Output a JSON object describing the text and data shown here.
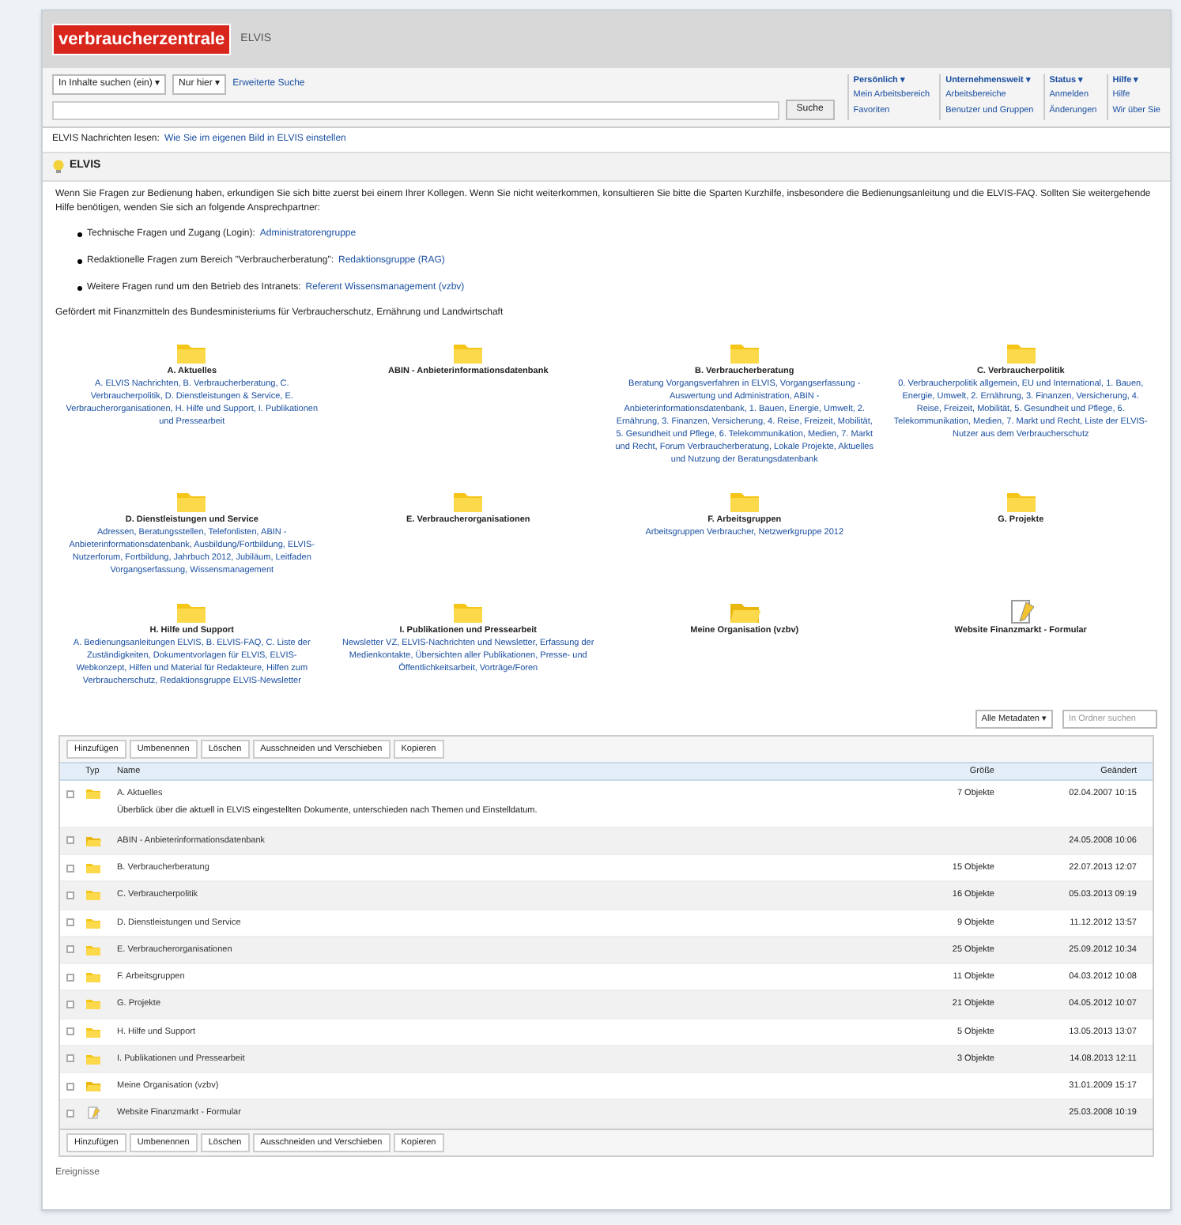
{
  "header": {
    "logo": "verbraucherzentrale",
    "subtitle": "ELVIS"
  },
  "search": {
    "scope": "In Inhalte suchen (ein) ▾",
    "filter": "Nur hier ▾",
    "advanced": "Erweiterte Suche",
    "button": "Suche"
  },
  "menus": [
    {
      "label": "Persönlich ▾",
      "items": [
        "Mein Arbeitsbereich",
        "Favoriten"
      ]
    },
    {
      "label": "Unternehmensweit ▾",
      "items": [
        "Arbeitsbereiche",
        "Benutzer und Gruppen"
      ]
    },
    {
      "label": "Status ▾",
      "items": [
        "Anmelden",
        "Änderungen"
      ]
    },
    {
      "label": "Hilfe ▾",
      "items": [
        "Hilfe",
        "Wir über Sie"
      ]
    }
  ],
  "breadcrumb": {
    "label": "ELVIS Nachrichten lesen:",
    "link": "Wie Sie im eigenen Bild in ELVIS einstellen"
  },
  "page_title": "ELVIS",
  "intro": "Wenn Sie Fragen zur Bedienung haben, erkundigen Sie sich bitte zuerst bei einem Ihrer Kollegen. Wenn Sie nicht weiterkommen, konsultieren Sie bitte die Sparten Kurzhilfe, insbesondere die Bedienungsanleitung und die ELVIS-FAQ. Sollten Sie weitergehende Hilfe benötigen, wenden Sie sich an folgende Ansprechpartner:",
  "contacts": [
    {
      "text": "Technische Fragen und Zugang (Login):",
      "link": "Administratorengruppe"
    },
    {
      "text": "Redaktionelle Fragen zum Bereich \"Verbraucherberatung\":",
      "link": "Redaktionsgruppe (RAG)"
    },
    {
      "text": "Weitere Fragen rund um den Betrieb des Intranets:",
      "link": "Referent Wissensmanagement (vzbv)"
    }
  ],
  "funding": "Gefördert mit Finanzmitteln des Bundesministeriums für Verbraucherschutz, Ernährung und Landwirtschaft",
  "folders": [
    {
      "kind": "folder",
      "title": "A. Aktuelles",
      "description": "A. ELVIS Nachrichten, B. Verbraucherberatung, C. Verbraucherpolitik, D. Dienstleistungen & Service, E. Verbraucherorganisationen, H. Hilfe und Support, I. Publikationen und Pressearbeit"
    },
    {
      "kind": "folder",
      "title": "ABIN - Anbieterinformationsdatenbank"
    },
    {
      "kind": "folder",
      "title": "B. Verbraucherberatung",
      "description": "Beratung Vorgangsverfahren in ELVIS, Vorgangserfassung - Auswertung und Administration, ABIN - Anbieterinformationsdatenbank, 1. Bauen, Energie, Umwelt, 2. Ernährung, 3. Finanzen, Versicherung, 4. Reise, Freizeit, Mobilität, 5. Gesundheit und Pflege, 6. Telekommunikation, Medien, 7. Markt und Recht, Forum Verbraucherberatung, Lokale Projekte, Aktuelles und Nutzung der Beratungsdatenbank"
    },
    {
      "kind": "folder",
      "title": "C. Verbraucherpolitik",
      "description": "0. Verbraucherpolitik allgemein, EU und International, 1. Bauen, Energie, Umwelt, 2. Ernährung, 3. Finanzen, Versicherung, 4. Reise, Freizeit, Mobilität, 5. Gesundheit und Pflege, 6. Telekommunikation, Medien, 7. Markt und Recht, Liste der ELVIS-Nutzer aus dem Verbraucherschutz"
    },
    {
      "kind": "folder",
      "title": "D. Dienstleistungen und Service",
      "description": "Adressen, Beratungsstellen, Telefonlisten, ABIN - Anbieterinformationsdatenbank, Ausbildung/Fortbildung, ELVIS-Nutzerforum, Fortbildung, Jahrbuch 2012, Jubiläum, Leitfaden Vorgangserfassung, Wissensmanagement"
    },
    {
      "kind": "folder",
      "title": "E. Verbraucherorganisationen"
    },
    {
      "kind": "folder",
      "title": "F. Arbeitsgruppen",
      "description": "Arbeitsgruppen Verbraucher, Netzwerkgruppe 2012"
    },
    {
      "kind": "folder",
      "title": "G. Projekte"
    },
    {
      "kind": "folder",
      "title": "H. Hilfe und Support",
      "description": "A. Bedienungsanleitungen ELVIS, B. ELVIS-FAQ, C. Liste der Zuständigkeiten, Dokumentvorlagen für ELVIS, ELVIS-Webkonzept, Hilfen und Material für Redakteure, Hilfen zum Verbraucherschutz, Redaktionsgruppe ELVIS-Newsletter"
    },
    {
      "kind": "folder",
      "title": "I. Publikationen und Pressearbeit",
      "description": "Newsletter VZ, ELVIS-Nachrichten und Newsletter, Erfassung der Medienkontakte, Übersichten aller Publikationen, Presse- und Öffentlichkeitsarbeit, Vorträge/Foren"
    },
    {
      "kind": "shared",
      "title": "Meine Organisation (vzbv)"
    },
    {
      "kind": "page",
      "title": "Website Finanzmarkt - Formular"
    }
  ],
  "list_controls": {
    "view": "Alle Metadaten ▾",
    "search_placeholder": "In Ordner suchen"
  },
  "actions_top": [
    "Hinzufügen",
    "Umbenennen",
    "Löschen",
    "Ausschneiden und Verschieben",
    "Kopieren"
  ],
  "actions_bottom": [
    "Hinzufügen",
    "Umbenennen",
    "Löschen",
    "Ausschneiden und Verschieben",
    "Kopieren"
  ],
  "columns": [
    "Typ",
    "Name",
    "Größe",
    "Geändert"
  ],
  "rows": [
    {
      "kind": "folder",
      "name": "A. Aktuelles",
      "checked": false,
      "size": "7 Objekte",
      "date": "02.04.2007 10:15",
      "note": "Überblick über die aktuell in ELVIS eingestellten Dokumente, unterschieden nach Themen und Einstelldatum."
    },
    {
      "kind": "shared",
      "name": "ABIN - Anbieterinformationsdatenbank",
      "checked": false,
      "date": "24.05.2008 10:06"
    },
    {
      "kind": "folder",
      "name": "B. Verbraucherberatung",
      "checked": false,
      "size": "15 Objekte",
      "date": "22.07.2013 12:07"
    },
    {
      "kind": "folder",
      "name": "C. Verbraucherpolitik",
      "checked": false,
      "size": "16 Objekte",
      "date": "05.03.2013 09:19"
    },
    {
      "kind": "folder",
      "name": "D. Dienstleistungen und Service",
      "checked": false,
      "size": "9 Objekte",
      "date": "11.12.2012 13:57"
    },
    {
      "kind": "folder",
      "name": "E. Verbraucherorganisationen",
      "checked": false,
      "size": "25 Objekte",
      "date": "25.09.2012 10:34"
    },
    {
      "kind": "folder",
      "name": "F. Arbeitsgruppen",
      "checked": false,
      "size": "11 Objekte",
      "date": "04.03.2012 10:08"
    },
    {
      "kind": "folder",
      "name": "G. Projekte",
      "checked": false,
      "size": "21 Objekte",
      "date": "04.05.2012 10:07"
    },
    {
      "kind": "folder",
      "name": "H. Hilfe und Support",
      "checked": false,
      "size": "5 Objekte",
      "date": "13.05.2013 13:07"
    },
    {
      "kind": "folder",
      "name": "I. Publikationen und Pressearbeit",
      "checked": false,
      "size": "3 Objekte",
      "date": "14.08.2013 12:11"
    },
    {
      "kind": "shared",
      "name": "Meine Organisation (vzbv)",
      "checked": false,
      "date": "31.01.2009 15:17"
    },
    {
      "kind": "page",
      "name": "Website Finanzmarkt - Formular",
      "checked": false,
      "date": "25.03.2008 10:19"
    }
  ],
  "footer": "Ereignisse"
}
